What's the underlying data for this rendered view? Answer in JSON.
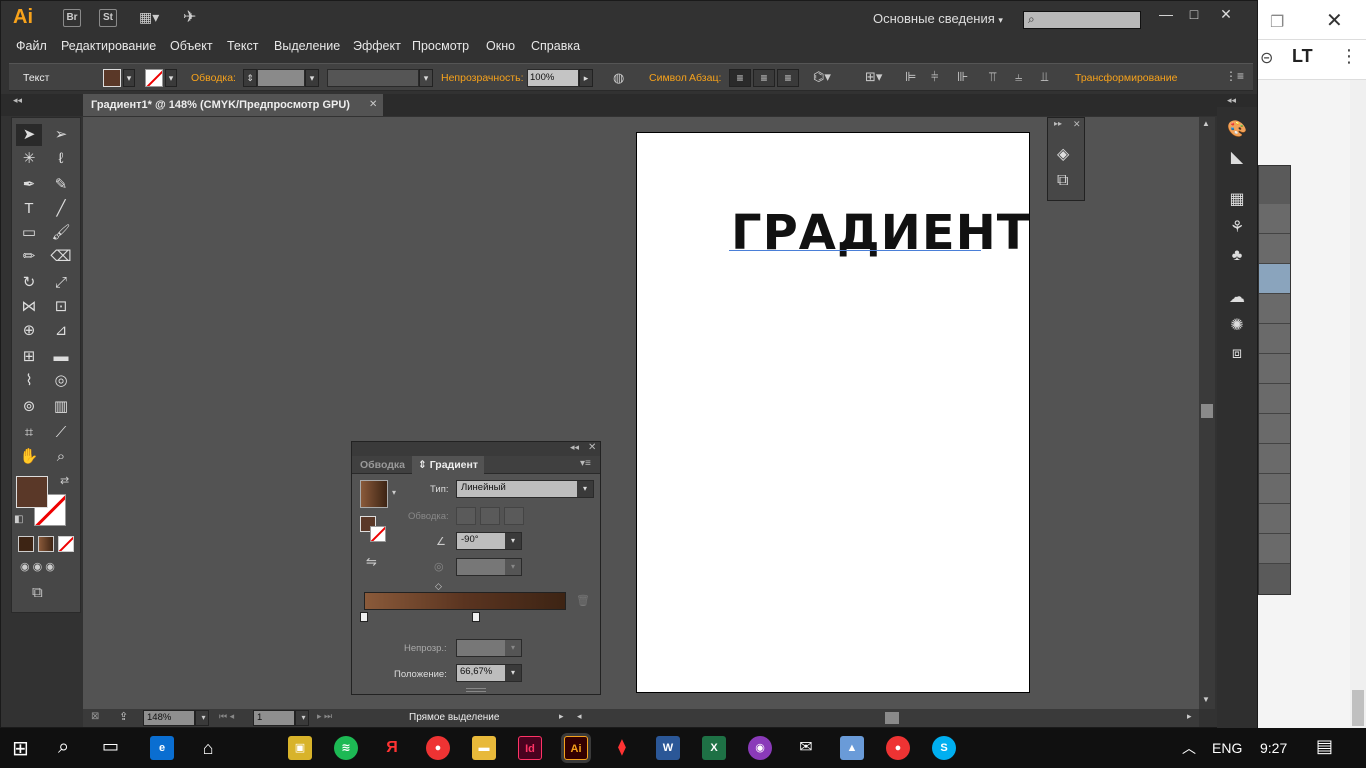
{
  "titlebar": {
    "app_logo": "Ai",
    "bridge": "Br",
    "stock": "St",
    "workspace": "Основные сведения"
  },
  "menu": [
    "Файл",
    "Редактирование",
    "Объект",
    "Текст",
    "Выделение",
    "Эффект",
    "Просмотр",
    "Окно",
    "Справка"
  ],
  "control": {
    "mode": "Текст",
    "stroke_label": "Обводка:",
    "opacity_label": "Непрозрачность:",
    "opacity_value": "100%",
    "symbol_label": "Символ",
    "paragraph_label": "Абзац:",
    "transform_label": "Трансформирование"
  },
  "document": {
    "tab_title": "Градиент1* @ 148% (CMYK/Предпросмотр GPU)",
    "heading": "ГРАДИЕНТ"
  },
  "gradient_panel": {
    "tab_stroke": "Обводка",
    "tab_gradient": "Градиент",
    "type_label": "Тип:",
    "type_value": "Линейный",
    "stroke_label": "Обводка:",
    "angle_value": "-90°",
    "opacity_label": "Непрозр.:",
    "position_label": "Положение:",
    "position_value": "66,67%"
  },
  "status": {
    "zoom": "148%",
    "artboard": "1",
    "tool": "Прямое выделение"
  },
  "taskbar": {
    "language": "ENG",
    "time": "9:27"
  },
  "colors": {
    "fill": "#5a3828",
    "accent": "#f7a21b"
  }
}
